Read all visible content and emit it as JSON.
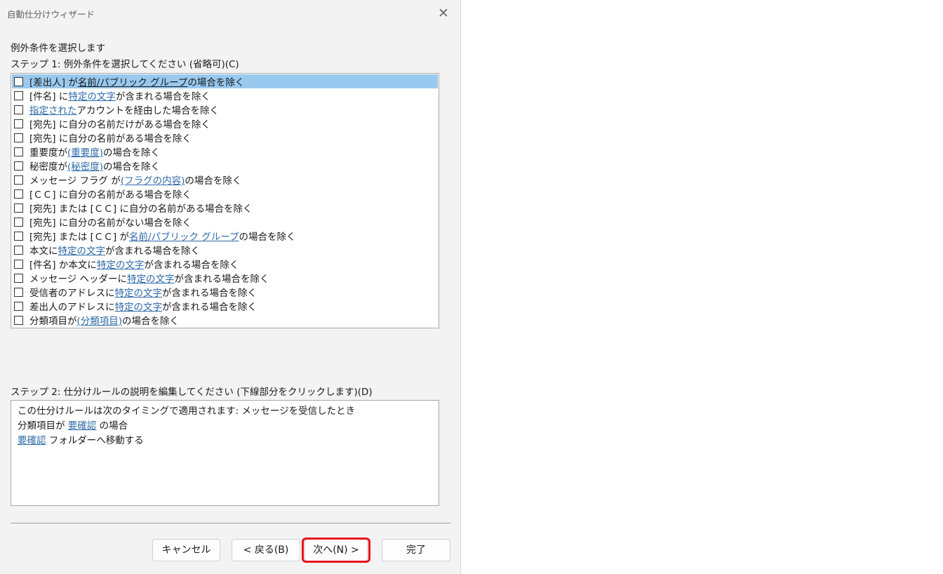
{
  "window": {
    "title": "自動仕分けウィザード",
    "close_glyph": "✕"
  },
  "heading": "例外条件を選択します",
  "step1_label": "ステップ 1: 例外条件を選択してください (省略可)(C)",
  "conditions": [
    {
      "checked": false,
      "segments": [
        {
          "text": "[差出人] が "
        },
        {
          "text": "名前/パブリック グループ",
          "link": true
        },
        {
          "text": " の場合を除く"
        }
      ]
    },
    {
      "checked": false,
      "segments": [
        {
          "text": "[件名] に "
        },
        {
          "text": "特定の文字",
          "link": true
        },
        {
          "text": " が含まれる場合を除く"
        }
      ]
    },
    {
      "checked": false,
      "segments": [
        {
          "text": "指定された",
          "link": true
        },
        {
          "text": " アカウントを経由した場合を除く"
        }
      ]
    },
    {
      "checked": false,
      "segments": [
        {
          "text": "[宛先] に自分の名前だけがある場合を除く"
        }
      ]
    },
    {
      "checked": false,
      "segments": [
        {
          "text": "[宛先] に自分の名前がある場合を除く"
        }
      ]
    },
    {
      "checked": false,
      "segments": [
        {
          "text": "重要度が "
        },
        {
          "text": "(重要度)",
          "link": true
        },
        {
          "text": " の場合を除く"
        }
      ]
    },
    {
      "checked": false,
      "segments": [
        {
          "text": "秘密度が "
        },
        {
          "text": "(秘密度)",
          "link": true
        },
        {
          "text": " の場合を除く"
        }
      ]
    },
    {
      "checked": false,
      "segments": [
        {
          "text": "メッセージ フラグ が "
        },
        {
          "text": "(フラグの内容)",
          "link": true
        },
        {
          "text": " の場合を除く"
        }
      ]
    },
    {
      "checked": false,
      "segments": [
        {
          "text": "[ＣＣ] に自分の名前がある場合を除く"
        }
      ]
    },
    {
      "checked": false,
      "segments": [
        {
          "text": "[宛先] または [ＣＣ] に自分の名前がある場合を除く"
        }
      ]
    },
    {
      "checked": false,
      "segments": [
        {
          "text": "[宛先] に自分の名前がない場合を除く"
        }
      ]
    },
    {
      "checked": false,
      "segments": [
        {
          "text": "[宛先] または [ＣＣ] が "
        },
        {
          "text": "名前/パブリック グループ",
          "link": true
        },
        {
          "text": " の場合を除く"
        }
      ]
    },
    {
      "checked": false,
      "segments": [
        {
          "text": "本文に "
        },
        {
          "text": "特定の文字",
          "link": true
        },
        {
          "text": " が含まれる場合を除く"
        }
      ]
    },
    {
      "checked": false,
      "segments": [
        {
          "text": "[件名] か本文に "
        },
        {
          "text": "特定の文字",
          "link": true
        },
        {
          "text": " が含まれる場合を除く"
        }
      ]
    },
    {
      "checked": false,
      "segments": [
        {
          "text": "メッセージ ヘッダーに "
        },
        {
          "text": "特定の文字",
          "link": true
        },
        {
          "text": " が含まれる場合を除く"
        }
      ]
    },
    {
      "checked": false,
      "segments": [
        {
          "text": "受信者のアドレスに "
        },
        {
          "text": "特定の文字",
          "link": true
        },
        {
          "text": " が含まれる場合を除く"
        }
      ]
    },
    {
      "checked": false,
      "segments": [
        {
          "text": "差出人のアドレスに "
        },
        {
          "text": "特定の文字",
          "link": true
        },
        {
          "text": " が含まれる場合を除く"
        }
      ]
    },
    {
      "checked": false,
      "segments": [
        {
          "text": "分類項目が "
        },
        {
          "text": "(分類項目)",
          "link": true
        },
        {
          "text": " の場合を除く"
        }
      ]
    }
  ],
  "selected_index": 0,
  "step2_label": "ステップ 2: 仕分けルールの説明を編集してください (下線部分をクリックします)(D)",
  "description_lines": [
    [
      {
        "text": "この仕分けルールは次のタイミングで適用されます: メッセージを受信したとき"
      }
    ],
    [
      {
        "text": "分類項目が "
      },
      {
        "text": "要確認",
        "link": true
      },
      {
        "text": " の場合"
      }
    ],
    [
      {
        "text": "要確認",
        "link": true
      },
      {
        "text": " フォルダーへ移動する"
      }
    ]
  ],
  "buttons": {
    "cancel": "キャンセル",
    "back": "< 戻る(B)",
    "next": "次へ(N) >",
    "finish": "完了"
  },
  "highlight_color": "#e8141c"
}
